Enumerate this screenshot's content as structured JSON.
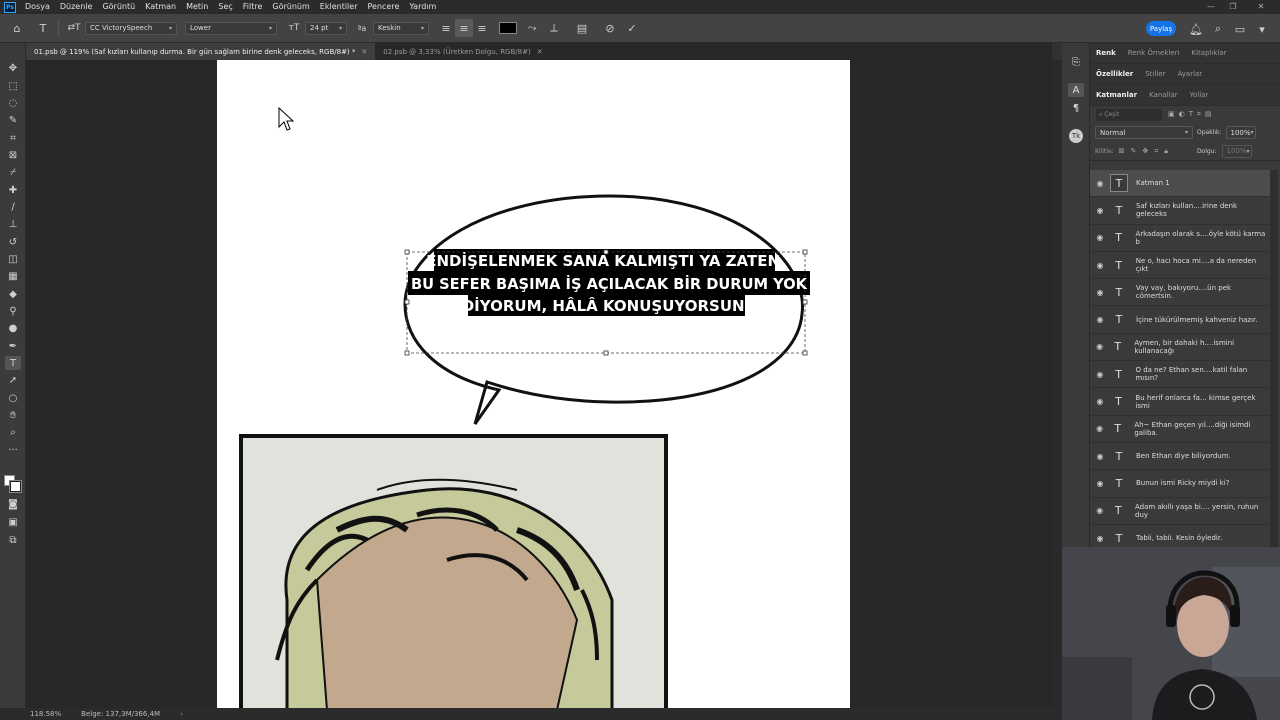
{
  "menubar": {
    "items": [
      "Dosya",
      "Düzenle",
      "Görüntü",
      "Katman",
      "Metin",
      "Seç",
      "Filtre",
      "Görünüm",
      "Eklentiler",
      "Pencere",
      "Yardım"
    ]
  },
  "options": {
    "font_family": "CC VictorySpeech",
    "font_style": "Lower",
    "font_size": "24 pt",
    "antialias": "Keskin",
    "text_color": "#000000",
    "share_label": "Paylaş"
  },
  "tabs": [
    {
      "label": "01.psb @ 119% (Saf kızları kullanıp durma. Bir gün sağlam birine denk geleceks, RGB/8#) *",
      "active": true
    },
    {
      "label": "02.psb @ 3,33% (Üretken Dolgu, RGB/8#)",
      "active": false
    }
  ],
  "canvas": {
    "bubble_lines": [
      "ENDİŞELENMEK SANA KALMIŞTI YA ZATEN.",
      "BU SEFER BAŞIMA İŞ AÇILACAK BİR DURUM YOK",
      "DİYORUM, HÂLÂ KONUŞUYORSUN."
    ]
  },
  "status": {
    "zoom": "118.58%",
    "doc_info": "Belge: 137,3M/366,4M"
  },
  "panel": {
    "top_tabs": [
      "Renk",
      "Renk Örnekleri",
      "Kitaplıklar"
    ],
    "mid_tabs": [
      "Özellikler",
      "Stiller",
      "Ayarlar"
    ],
    "layer_tabs": [
      "Katmanlar",
      "Kanallar",
      "Yollar"
    ],
    "search_placeholder": "Çeşit",
    "blend_mode": "Normal",
    "opacity_label": "Opaklık:",
    "opacity_value": "100%",
    "lock_label": "Kilitle:",
    "fill_label": "Dolgu:",
    "fill_value": "100%",
    "layers": [
      {
        "name": "Katman 1",
        "selected": true
      },
      {
        "name": "Saf kızları kullan....irine denk geleceks",
        "selected": false
      },
      {
        "name": "Arkadaşın olarak s....öyle kötü karma b",
        "selected": false
      },
      {
        "name": "Ne o, hacı hoca mi....a da nereden çıkt",
        "selected": false
      },
      {
        "name": "Vay vay, bakıyoru....ün pek cömertsin.",
        "selected": false
      },
      {
        "name": "İçine tükürülmemiş kahveniz hazır.",
        "selected": false
      },
      {
        "name": "Aymen, bir dahaki h....ismini kullanacağı",
        "selected": false
      },
      {
        "name": "O da ne? Ethan sen....katil falan mısın?",
        "selected": false
      },
      {
        "name": "Bu herif onlarca fa... kimse gerçek ismi",
        "selected": false
      },
      {
        "name": "Ah~ Ethan geçen yıl....diği isimdi galiba.",
        "selected": false
      },
      {
        "name": "Ben Ethan diye biliyordum.",
        "selected": false
      },
      {
        "name": "Bunun ismi Ricky miydi ki?",
        "selected": false
      },
      {
        "name": "Adam akıllı yaşa bi.... yersin, ruhun duy",
        "selected": false
      },
      {
        "name": "Tabii, tabii. Kesin öyledir.",
        "selected": false
      }
    ]
  }
}
